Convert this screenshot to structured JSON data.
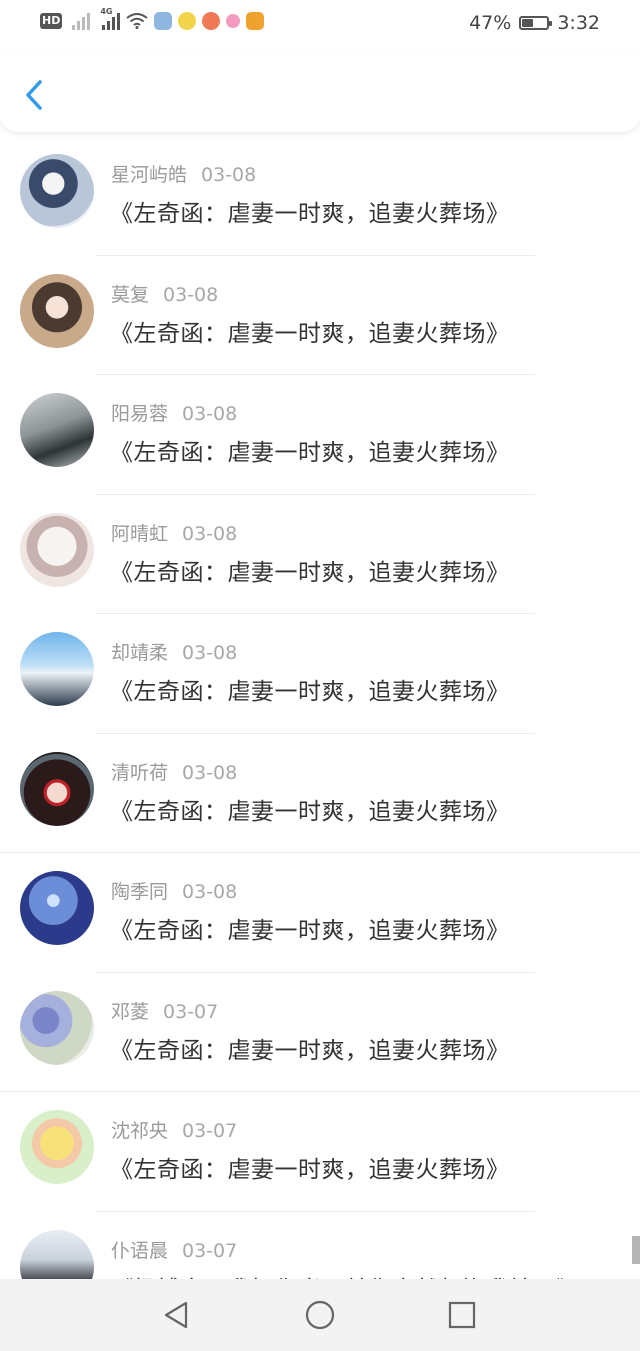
{
  "status_bar": {
    "hd_label": "HD",
    "net_label_1": "",
    "net_label_2": "4G",
    "battery_percent_text": "47%",
    "battery_level": 0.47,
    "time": "3:32"
  },
  "header": {
    "back_icon": "chevron-left-icon",
    "accent_color": "#2f9be8"
  },
  "items": [
    {
      "name": "星河屿皓",
      "date": "03-08",
      "message": "《左奇函：虐妻一时爽，追妻火葬场》"
    },
    {
      "name": "莫复",
      "date": "03-08",
      "message": "《左奇函：虐妻一时爽，追妻火葬场》"
    },
    {
      "name": "阳易蓉",
      "date": "03-08",
      "message": "《左奇函：虐妻一时爽，追妻火葬场》"
    },
    {
      "name": "阿晴虹",
      "date": "03-08",
      "message": "《左奇函：虐妻一时爽，追妻火葬场》"
    },
    {
      "name": "却靖柔",
      "date": "03-08",
      "message": "《左奇函：虐妻一时爽，追妻火葬场》"
    },
    {
      "name": "清听荷",
      "date": "03-08",
      "message": "《左奇函：虐妻一时爽，追妻火葬场》"
    },
    {
      "name": "陶季同",
      "date": "03-08",
      "message": "《左奇函：虐妻一时爽，追妻火葬场》"
    },
    {
      "name": "邓菱",
      "date": "03-07",
      "message": "《左奇函：虐妻一时爽，追妻火葬场》"
    },
    {
      "name": "沈祁央",
      "date": "03-07",
      "message": "《左奇函：虐妻一时爽，追妻火葬场》"
    },
    {
      "name": "仆语晨",
      "date": "03-07",
      "message": "《杨博文：我把你当兄弟你竟然想泡我妹？》"
    }
  ],
  "nav_bar": {
    "back_icon": "triangle-back-icon",
    "home_icon": "circle-home-icon",
    "recents_icon": "square-recents-icon"
  }
}
